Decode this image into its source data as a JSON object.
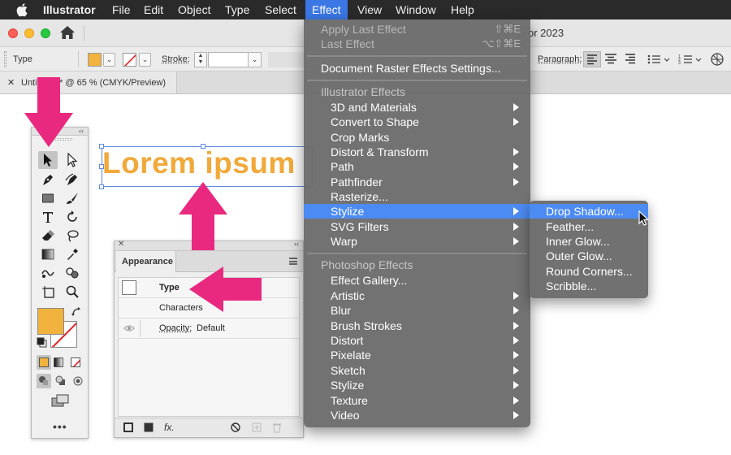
{
  "menubar": {
    "app_name": "Illustrator",
    "items": [
      "File",
      "Edit",
      "Object",
      "Type",
      "Select",
      "Effect",
      "View",
      "Window",
      "Help"
    ],
    "active_item": "Effect"
  },
  "window": {
    "title_partial": "or 2023"
  },
  "control_bar": {
    "selection_type": "Type",
    "stroke_label": "Stroke:",
    "paragraph_label": "Paragraph:",
    "fill_color": "#f1b33e"
  },
  "document_tab": {
    "label": "Untitled-1* @ 65 % (CMYK/Preview)"
  },
  "canvas": {
    "text": "Lorem ipsum",
    "text_color": "#f1a93a"
  },
  "appearance_panel": {
    "tab_label": "Appearance",
    "row_type": "Type",
    "row_characters": "Characters",
    "opacity_label": "Opacity:",
    "opacity_value": "Default"
  },
  "effect_menu": {
    "apply_last": "Apply Last Effect",
    "apply_last_shortcut": "⇧⌘E",
    "last_effect": "Last Effect",
    "last_effect_shortcut": "⌥⇧⌘E",
    "raster_settings": "Document Raster Effects Settings...",
    "illustrator_header": "Illustrator Effects",
    "illustrator_items": [
      "3D and Materials",
      "Convert to Shape",
      "Crop Marks",
      "Distort & Transform",
      "Path",
      "Pathfinder",
      "Rasterize...",
      "Stylize",
      "SVG Filters",
      "Warp"
    ],
    "photoshop_header": "Photoshop Effects",
    "photoshop_items": [
      "Effect Gallery...",
      "Artistic",
      "Blur",
      "Brush Strokes",
      "Distort",
      "Pixelate",
      "Sketch",
      "Stylize",
      "Texture",
      "Video"
    ],
    "highlighted_item": "Stylize"
  },
  "stylize_submenu": {
    "items": [
      "Drop Shadow...",
      "Feather...",
      "Inner Glow...",
      "Outer Glow...",
      "Round Corners...",
      "Scribble..."
    ],
    "highlighted_item": "Drop Shadow..."
  },
  "colors": {
    "accent_blue": "#4c8bf1",
    "annotation_pink": "#e8297f",
    "menubar_bg": "#2a2a2a"
  }
}
